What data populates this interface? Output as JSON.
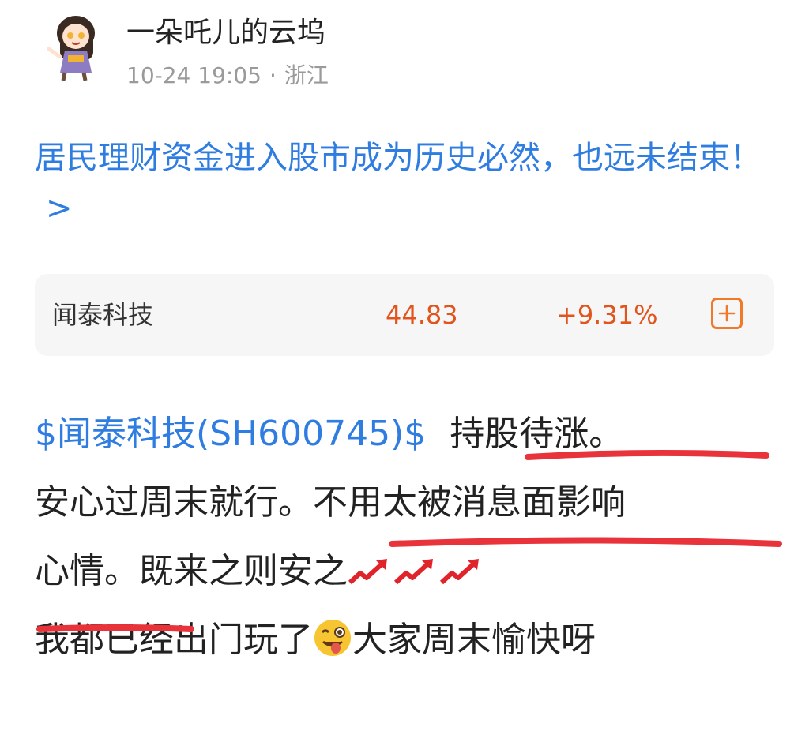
{
  "post": {
    "username": "一朵吒儿的云坞",
    "timestamp": "10-24 19:05",
    "separator": "·",
    "location": "浙江"
  },
  "headline": {
    "text": "居民理财资金进入股市成为历史必然，也远未结束！",
    "chevron": ">"
  },
  "stock_card": {
    "name": "闻泰科技",
    "price": "44.83",
    "change": "+9.31%",
    "add_icon": "plus-square-icon",
    "accent_color": "#e1541c"
  },
  "body": {
    "tag": "$闻泰科技(SH600745)$",
    "line1_rest": "持股待涨。",
    "line2": "安心过周末就行。不用太被消息面影响",
    "line3": "心情。既来之则安之",
    "line4a": "我都已经出门玩了",
    "line4b": "大家周末愉快呀",
    "emoji_arrows": "chart-increasing-arrow-icon",
    "emoji_face": "winking-tongue-face-icon",
    "underline_color": "#e8333a"
  }
}
